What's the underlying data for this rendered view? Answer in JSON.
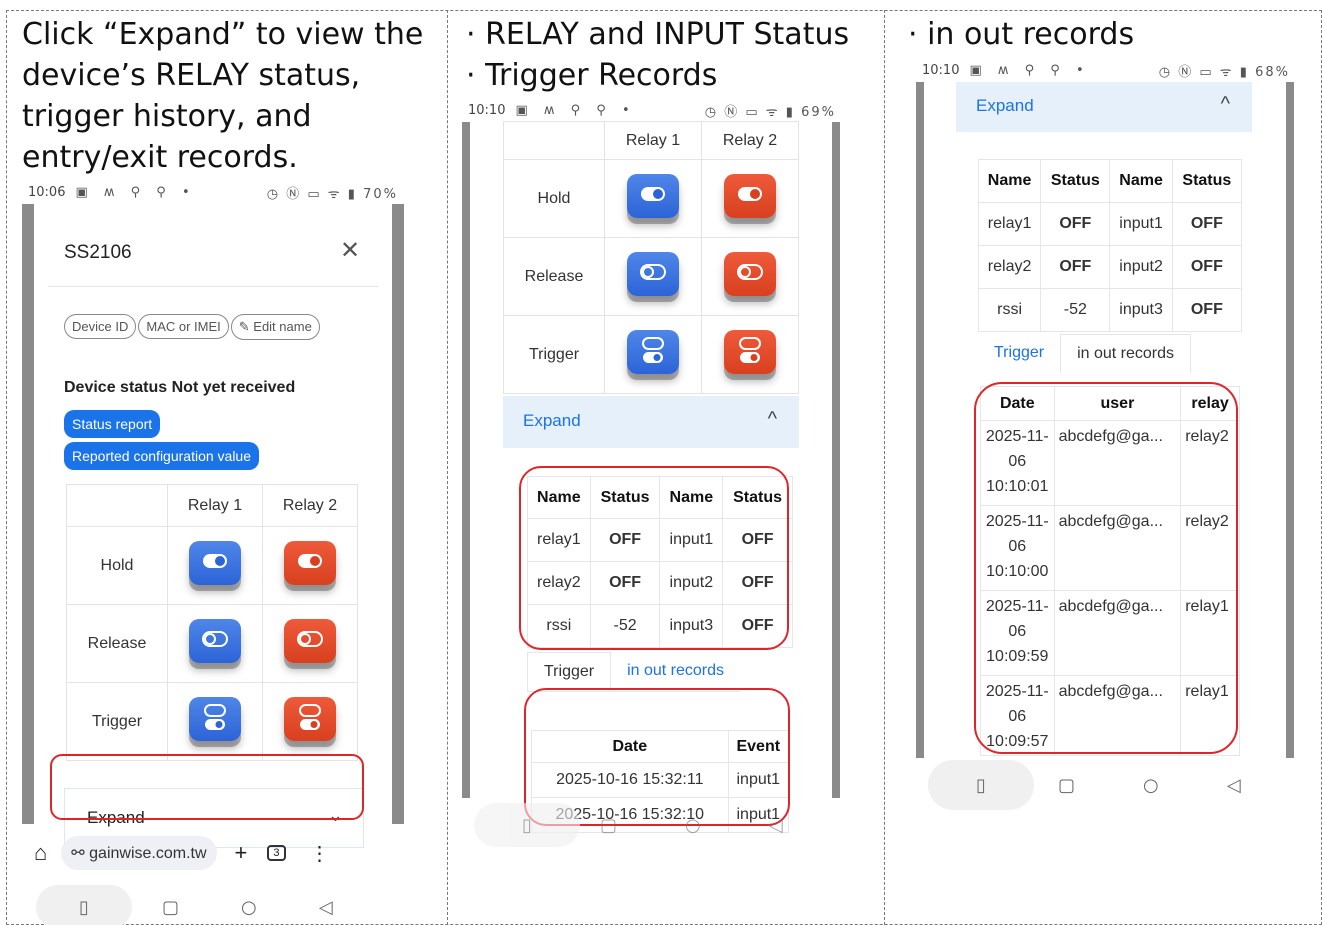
{
  "captions": {
    "left": "Click “Expand” to view the device’s RELAY status, trigger history, and entry/exit records.",
    "middle_line1": "· RELAY and INPUT Status",
    "middle_line2": "· Trigger Records",
    "right": "· in out records"
  },
  "phone1": {
    "status_time": "10:06",
    "battery": "70%",
    "dialog_title": "SS2106",
    "close_icon": "close-icon",
    "chips": [
      "Device ID",
      "MAC or IMEI",
      "✎ Edit name"
    ],
    "device_status_label": "Device status Not yet received",
    "status_report_button": "Status report",
    "reported_config_button": "Reported configuration value",
    "relay_headers": [
      "Relay 1",
      "Relay 2"
    ],
    "rows": [
      "Hold",
      "Release",
      "Trigger"
    ],
    "expand_label": "Expand",
    "url": "gainwise.com.tw",
    "tab_count": "3"
  },
  "phone2": {
    "status_time": "10:10",
    "battery": "69%",
    "relay_headers": [
      "Relay 1",
      "Relay 2"
    ],
    "rows": [
      "Hold",
      "Release",
      "Trigger"
    ],
    "expand_label": "Expand",
    "status_headers": [
      "Name",
      "Status",
      "Name",
      "Status"
    ],
    "status_rows": [
      [
        "relay1",
        "OFF",
        "input1",
        "OFF"
      ],
      [
        "relay2",
        "OFF",
        "input2",
        "OFF"
      ],
      [
        "rssi",
        "-52",
        "input3",
        "OFF"
      ]
    ],
    "tabs": [
      "Trigger",
      "in out records"
    ],
    "trigger_headers": [
      "Date",
      "Event"
    ],
    "trigger_rows": [
      [
        "2025-10-16 15:32:11",
        "input1"
      ],
      [
        "2025-10-16 15:32:10",
        "input1"
      ]
    ]
  },
  "phone3": {
    "status_time": "10:10",
    "battery": "68%",
    "expand_label": "Expand",
    "status_headers": [
      "Name",
      "Status",
      "Name",
      "Status"
    ],
    "status_rows": [
      [
        "relay1",
        "OFF",
        "input1",
        "OFF"
      ],
      [
        "relay2",
        "OFF",
        "input2",
        "OFF"
      ],
      [
        "rssi",
        "-52",
        "input3",
        "OFF"
      ]
    ],
    "tabs": [
      "Trigger",
      "in out records"
    ],
    "record_headers": [
      "Date",
      "user",
      "relay"
    ],
    "record_rows": [
      [
        "2025-11-",
        "06",
        "10:10:01",
        "abcdefg@ga...",
        "relay2"
      ],
      [
        "2025-11-",
        "06",
        "10:10:00",
        "abcdefg@ga...",
        "relay2"
      ],
      [
        "2025-11-",
        "06",
        "10:09:59",
        "abcdefg@ga...",
        "relay1"
      ],
      [
        "2025-11-",
        "06",
        "10:09:57",
        "abcdefg@ga...",
        "relay1"
      ]
    ]
  },
  "colors": {
    "accent_blue": "#1a73e8",
    "relay2_red": "#e04a2a",
    "highlight_red": "#e0252a",
    "status_green": "#1a8a1a"
  }
}
